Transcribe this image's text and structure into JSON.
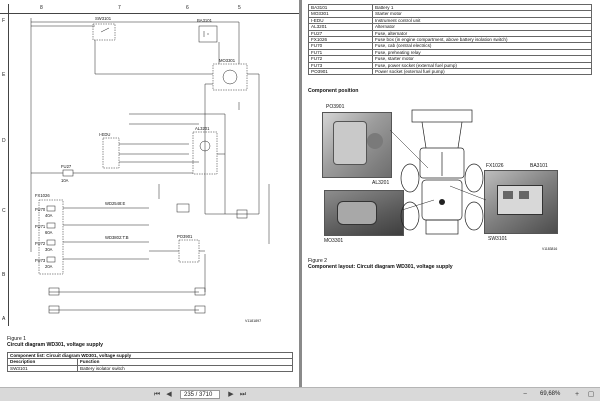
{
  "grid": {
    "columns": [
      "8",
      "7",
      "6",
      "5"
    ],
    "rows": [
      "F",
      "E",
      "D",
      "C",
      "B",
      "A"
    ]
  },
  "schematic": {
    "components": {
      "sw3101": "SW3101",
      "ba3101": "BA3101",
      "mo3301": "MO3301",
      "iedu": "I-EDU",
      "al3201": "AL3201",
      "fu27": "FU27",
      "fu27_rating": "10A",
      "fx1026": "FX1026",
      "fu70": "FU70",
      "fu71": "FU71",
      "fu72": "FU72",
      "fu73": "FU73",
      "fu70_rating": "40A",
      "fu71_rating": "60A",
      "fu72_rating": "30A",
      "fu73_rating": "20A",
      "po3901": "PO3901",
      "wd2548": "WD2548:E",
      "wd3802": "WD3802:T:B"
    },
    "figure_code": "V1181897"
  },
  "left_page": {
    "figure_label": "Figure 1",
    "figure_title": "Circuit diagram WD301, voltage supply",
    "component_list": {
      "title": "Component list: Circuit diagram WD301, voltage supply",
      "headers": [
        "Description",
        "Function"
      ],
      "rows": [
        [
          "SW3101",
          "Battery isolator switch"
        ]
      ]
    }
  },
  "right_page": {
    "component_rows": [
      [
        "BA3101",
        "Battery 1"
      ],
      [
        "MO3301",
        "Starter motor"
      ],
      [
        "I-EDU",
        "Instrument control unit"
      ],
      [
        "AL3201",
        "Alternator"
      ],
      [
        "FU27",
        "Fuse, alternator"
      ],
      [
        "FX1026",
        "Fuse box (in engine compartment, above battery isolation switch)"
      ],
      [
        "FU70",
        "Fuse, cab (central electrics)"
      ],
      [
        "FU71",
        "Fuse, preheating relay"
      ],
      [
        "FU72",
        "Fuse, starter motor"
      ],
      [
        "FU73",
        "Fuse, power socket (external fuel pump)"
      ],
      [
        "PO3901",
        "Power socket (external fuel pump)"
      ]
    ],
    "position_heading": "Component position",
    "photo_labels": {
      "po3901": "PO3901",
      "al3201": "AL3201",
      "mo3301": "MO3301",
      "fx1026": "FX1026",
      "ba3101": "BA3101",
      "sw3101": "SW3101"
    },
    "photo_code": "V1183816",
    "figure_label": "Figure 2",
    "figure_title": "Component layout: Circuit diagram WD301, voltage supply"
  },
  "status_bar": {
    "page_display": "235 / 3710",
    "zoom": "69,68%"
  },
  "colors": {
    "viewer_bg": "#8a8a8a",
    "page_bg": "#ffffff",
    "status_bar_bg": "#d9d9d9"
  }
}
